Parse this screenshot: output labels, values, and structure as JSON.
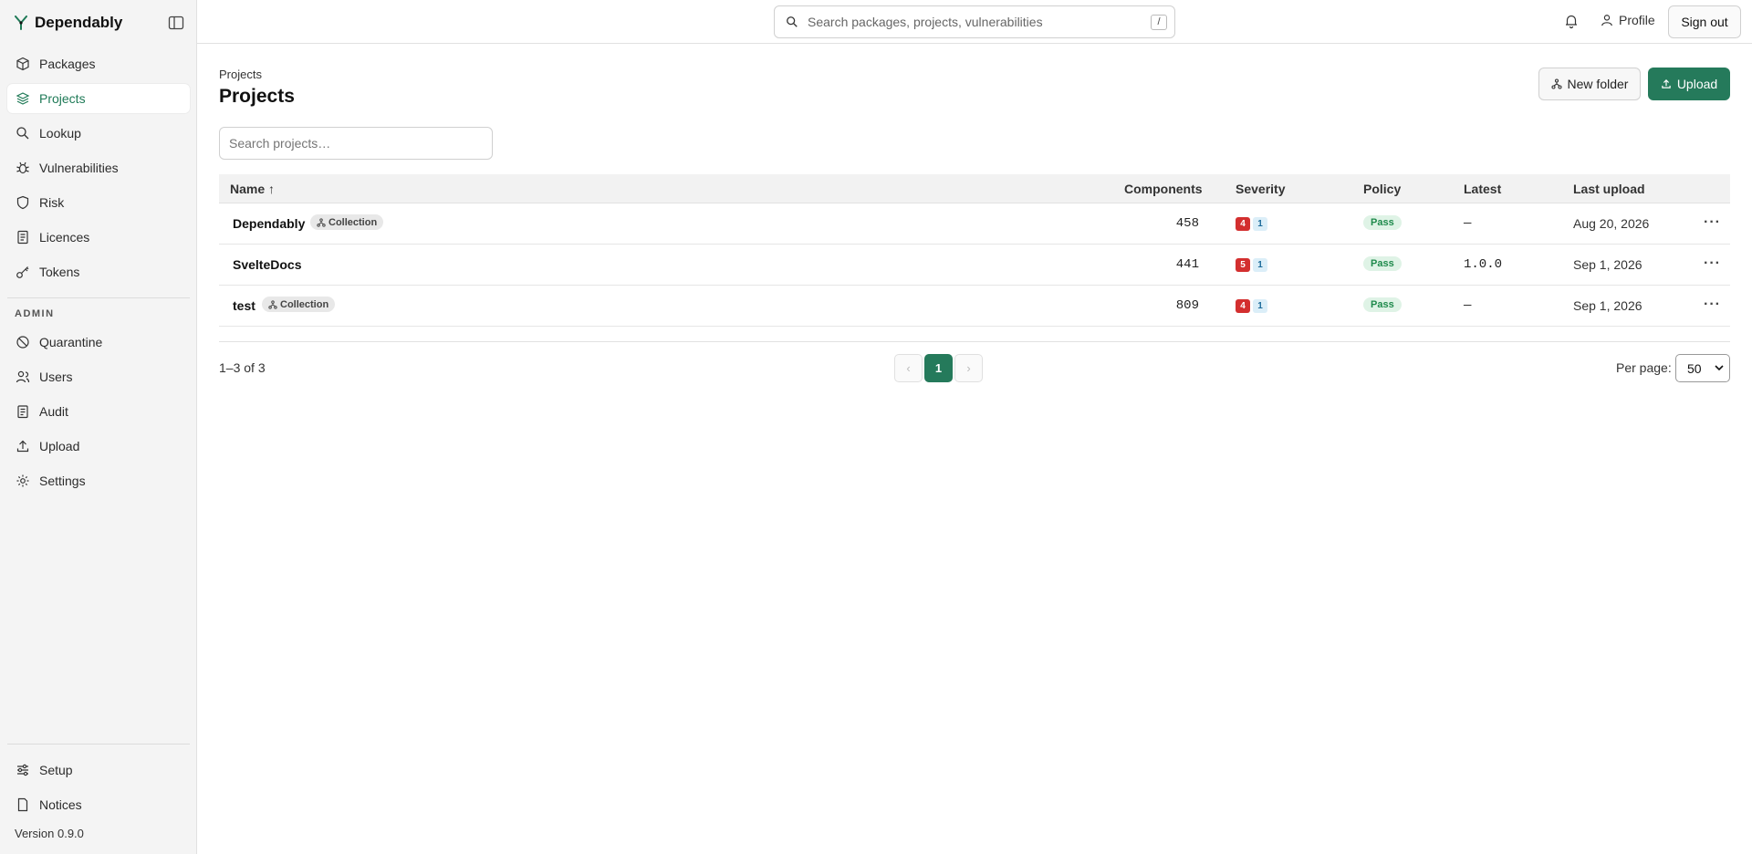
{
  "app": {
    "name": "Dependably",
    "version": "Version 0.9.0"
  },
  "sidebar": {
    "items": [
      {
        "label": "Packages",
        "icon": "package-icon"
      },
      {
        "label": "Projects",
        "icon": "layers-icon",
        "active": true
      },
      {
        "label": "Lookup",
        "icon": "search-icon"
      },
      {
        "label": "Vulnerabilities",
        "icon": "bug-icon"
      },
      {
        "label": "Risk",
        "icon": "shield-icon"
      },
      {
        "label": "Licences",
        "icon": "document-icon"
      },
      {
        "label": "Tokens",
        "icon": "key-icon"
      }
    ],
    "admin_label": "ADMIN",
    "admin_items": [
      {
        "label": "Quarantine",
        "icon": "ban-icon"
      },
      {
        "label": "Users",
        "icon": "users-icon"
      },
      {
        "label": "Audit",
        "icon": "clipboard-icon"
      },
      {
        "label": "Upload",
        "icon": "upload-icon"
      },
      {
        "label": "Settings",
        "icon": "gear-icon"
      }
    ],
    "footer_items": [
      {
        "label": "Setup",
        "icon": "sliders-icon"
      },
      {
        "label": "Notices",
        "icon": "file-icon"
      }
    ]
  },
  "topbar": {
    "search_placeholder": "Search packages, projects, vulnerabilities",
    "search_shortcut": "/",
    "profile_label": "Profile",
    "signout_label": "Sign out"
  },
  "page": {
    "breadcrumb": "Projects",
    "title": "Projects",
    "new_folder_label": "New folder",
    "upload_label": "Upload",
    "search_placeholder": "Search projects…"
  },
  "table": {
    "headers": {
      "name": "Name ↑",
      "components": "Components",
      "severity": "Severity",
      "policy": "Policy",
      "latest": "Latest",
      "last_upload": "Last upload"
    },
    "rows": [
      {
        "name": "Dependably",
        "tag": "Collection",
        "components": "458",
        "sev_critical": "4",
        "sev_low": "1",
        "policy": "Pass",
        "latest": "—",
        "last_upload": "Aug 20, 2026"
      },
      {
        "name": "SvelteDocs",
        "tag": "",
        "components": "441",
        "sev_critical": "5",
        "sev_low": "1",
        "policy": "Pass",
        "latest": "1.0.0",
        "last_upload": "Sep 1, 2026"
      },
      {
        "name": "test",
        "tag": "Collection",
        "components": "809",
        "sev_critical": "4",
        "sev_low": "1",
        "policy": "Pass",
        "latest": "—",
        "last_upload": "Sep 1, 2026"
      }
    ],
    "more_label": "···"
  },
  "pagination": {
    "count": "1–3 of 3",
    "prev": "‹",
    "current": "1",
    "next": "›",
    "per_page_label": "Per page:",
    "per_page_value": "50"
  },
  "colors": {
    "accent": "#257a5b",
    "critical": "#d32f2f",
    "low": "#1c6a9a",
    "pass": "#1f8a4c"
  }
}
